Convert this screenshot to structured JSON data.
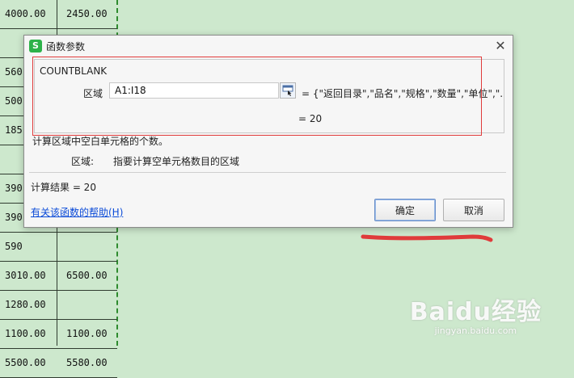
{
  "sheet": {
    "rows": [
      {
        "c1": "4000.00",
        "c2": "2450.00"
      },
      {
        "c1": "",
        "c2": ""
      },
      {
        "c1": "560",
        "c2": ""
      },
      {
        "c1": "500",
        "c2": ""
      },
      {
        "c1": "185",
        "c2": ""
      },
      {
        "c1": "",
        "c2": ""
      },
      {
        "c1": "390",
        "c2": ""
      },
      {
        "c1": "390",
        "c2": ""
      },
      {
        "c1": "590",
        "c2": ""
      },
      {
        "c1": "3010.00",
        "c2": "6500.00"
      },
      {
        "c1": "1280.00",
        "c2": ""
      },
      {
        "c1": "1100.00",
        "c2": "1100.00"
      },
      {
        "c1": "5500.00",
        "c2": "5580.00"
      }
    ]
  },
  "dialog": {
    "title": "函数参数",
    "app_icon_letter": "S",
    "close_symbol": "✕",
    "function_name": "COUNTBLANK",
    "param_label": "区域",
    "param_value": "A1:I18",
    "param_preview": "= {\"返回目录\",\"品名\",\"规格\",\"数量\",\"单位\",\"...",
    "inline_result": "=  20",
    "description": "计算区域中空白单元格的个数。",
    "param_help_name": "区域:",
    "param_help_desc": "指要计算空单元格数目的区域",
    "calc_result": "计算结果  =  20",
    "help_link": "有关该函数的帮助(H)",
    "ok_label": "确定",
    "cancel_label": "取消"
  },
  "watermark": {
    "logo": "Baidu经验",
    "url": "jingyan.baidu.com"
  },
  "colors": {
    "sheet_bg": "#cde8cd",
    "highlight_red": "#e03b3b",
    "link_blue": "#0b4bd8",
    "app_green": "#2db24a"
  }
}
